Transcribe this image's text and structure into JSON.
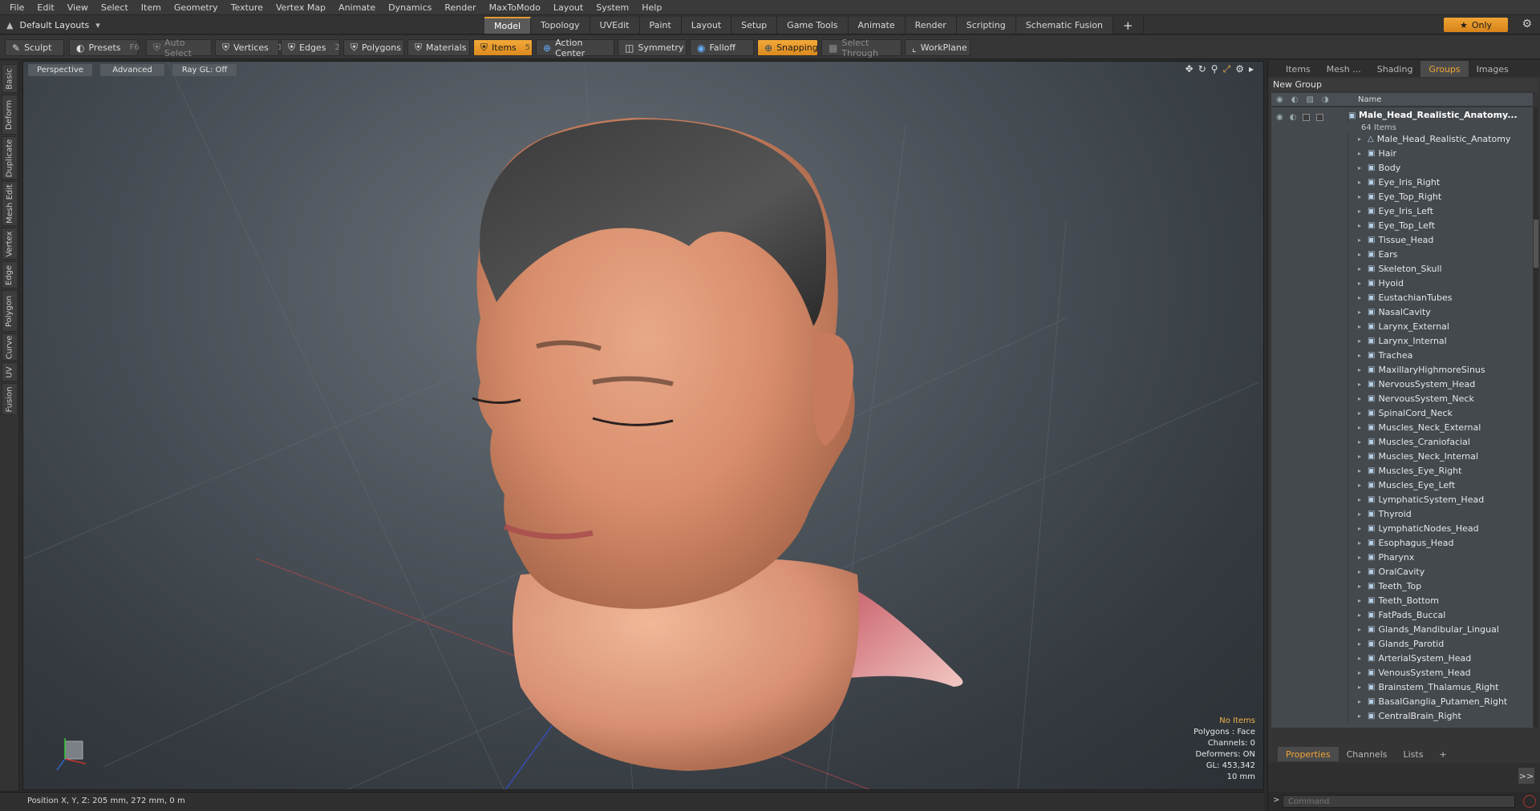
{
  "menu": [
    "File",
    "Edit",
    "View",
    "Select",
    "Item",
    "Geometry",
    "Texture",
    "Vertex Map",
    "Animate",
    "Dynamics",
    "Render",
    "MaxToModo",
    "Layout",
    "System",
    "Help"
  ],
  "layout_selector": "Default Layouts",
  "mode_tabs": [
    "Model",
    "Topology",
    "UVEdit",
    "Paint",
    "Layout",
    "Setup",
    "Game Tools",
    "Animate",
    "Render",
    "Scripting",
    "Schematic Fusion"
  ],
  "active_mode_tab": "Model",
  "only_button": "Only",
  "toolbar": {
    "sculpt": "Sculpt",
    "presets": "Presets",
    "presets_key": "F6",
    "auto_select": "Auto Select",
    "vertices": "Vertices",
    "vertices_key": "1",
    "edges": "Edges",
    "edges_key": "2",
    "polygons": "Polygons",
    "materials": "Materials",
    "items": "Items",
    "items_key": "5",
    "action_center": "Action Center",
    "symmetry": "Symmetry",
    "falloff": "Falloff",
    "snapping": "Snapping",
    "select_through": "Select Through",
    "workplane": "WorkPlane"
  },
  "left_tabs": [
    "Basic",
    "Deform",
    "Duplicate",
    "Mesh Edit",
    "Vertex",
    "Edge",
    "Polygon",
    "Curve",
    "UV",
    "Fusion"
  ],
  "viewport": {
    "view_mode": "Perspective",
    "shading": "Advanced",
    "raygl": "Ray GL: Off",
    "stats": {
      "no_items": "No Items",
      "polygons": "Polygons : Face",
      "channels": "Channels: 0",
      "deformers": "Deformers: ON",
      "gl": "GL: 453,342",
      "scale": "10 mm"
    }
  },
  "status": "Position X, Y, Z:  205 mm, 272 mm, 0 m",
  "right_panel": {
    "tabs": [
      "Items",
      "Mesh ...",
      "Shading",
      "Groups",
      "Images"
    ],
    "active_tab": "Groups",
    "new_group": "New Group",
    "col_name": "Name",
    "root": {
      "name": "Male_Head_Realistic_Anatomy...",
      "count": "64 Items"
    },
    "items": [
      "Male_Head_Realistic_Anatomy",
      "Hair",
      "Body",
      "Eye_Iris_Right",
      "Eye_Top_Right",
      "Eye_Iris_Left",
      "Eye_Top_Left",
      "Tissue_Head",
      "Ears",
      "Skeleton_Skull",
      "Hyoid",
      "EustachianTubes",
      "NasalCavity",
      "Larynx_External",
      "Larynx_Internal",
      "Trachea",
      "MaxillaryHighmoreSinus",
      "NervousSystem_Head",
      "NervousSystem_Neck",
      "SpinalCord_Neck",
      "Muscles_Neck_External",
      "Muscles_Craniofacial",
      "Muscles_Neck_Internal",
      "Muscles_Eye_Right",
      "Muscles_Eye_Left",
      "LymphaticSystem_Head",
      "Thyroid",
      "LymphaticNodes_Head",
      "Esophagus_Head",
      "Pharynx",
      "OralCavity",
      "Teeth_Top",
      "Teeth_Bottom",
      "FatPads_Buccal",
      "Glands_Mandibular_Lingual",
      "Glands_Parotid",
      "ArterialSystem_Head",
      "VenousSystem_Head",
      "Brainstem_Thalamus_Right",
      "BasalGanglia_Putamen_Right",
      "CentralBrain_Right"
    ],
    "bottom_tabs": [
      "Properties",
      "Channels",
      "Lists"
    ],
    "active_bottom_tab": "Properties",
    "command_placeholder": "Command"
  },
  "colors": {
    "accent": "#f0a534",
    "viewport_bg": "#4f565d"
  }
}
